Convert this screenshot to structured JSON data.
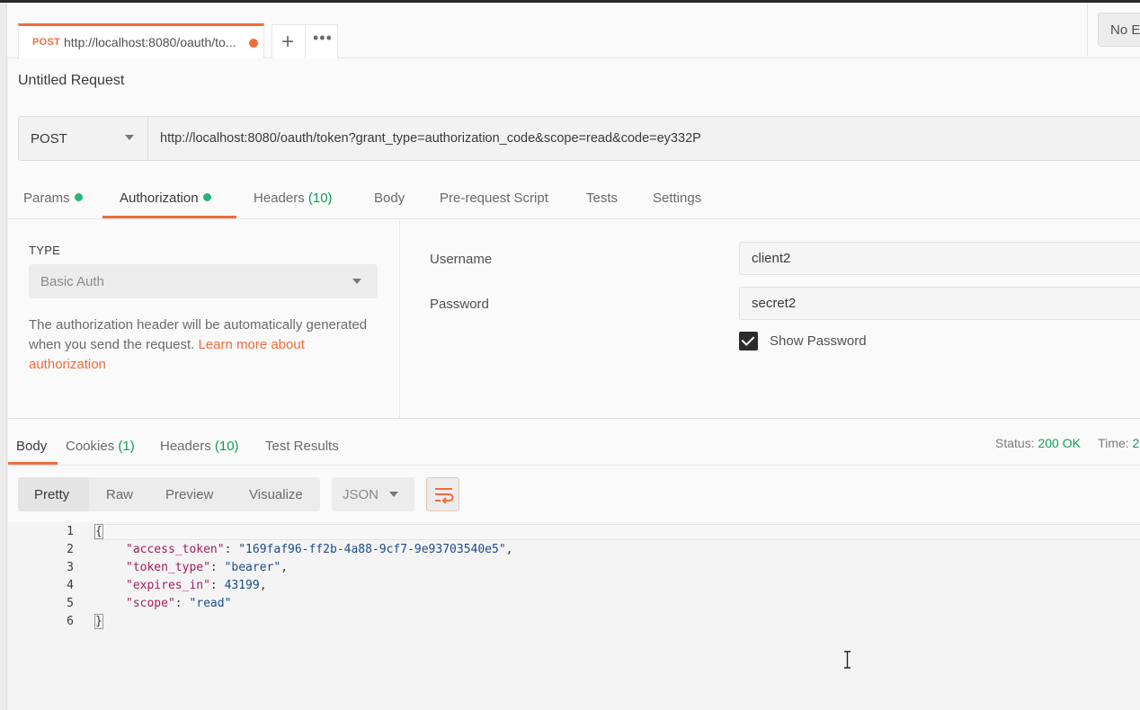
{
  "tab": {
    "method": "POST",
    "url": "http://localhost:8080/oauth/to...",
    "add_label": "+",
    "more_label": "•••"
  },
  "environment": {
    "label": "No E"
  },
  "request": {
    "title": "Untitled Request",
    "method": "POST",
    "url": "http://localhost:8080/oauth/token?grant_type=authorization_code&scope=read&code=ey332P"
  },
  "request_tabs": [
    {
      "label": "Params",
      "dot": true
    },
    {
      "label": "Authorization",
      "dot": true,
      "active": true
    },
    {
      "label": "Headers",
      "count": "(10)"
    },
    {
      "label": "Body"
    },
    {
      "label": "Pre-request Script"
    },
    {
      "label": "Tests"
    },
    {
      "label": "Settings"
    }
  ],
  "auth": {
    "type_label": "TYPE",
    "type_value": "Basic Auth",
    "description": "The authorization header will be automatically generated when you send the request.",
    "learn_more": "Learn more about authorization",
    "username_label": "Username",
    "username_value": "client2",
    "password_label": "Password",
    "password_value": "secret2",
    "show_password_label": "Show Password",
    "show_password_checked": true
  },
  "response_tabs": [
    {
      "label": "Body",
      "active": true
    },
    {
      "label": "Cookies",
      "count": "(1)"
    },
    {
      "label": "Headers",
      "count": "(10)"
    },
    {
      "label": "Test Results"
    }
  ],
  "status": {
    "status_label": "Status:",
    "status_value": "200 OK",
    "time_label": "Time:",
    "time_value": "2"
  },
  "format": {
    "buttons": [
      "Pretty",
      "Raw",
      "Preview",
      "Visualize"
    ],
    "active": "Pretty",
    "language": "JSON"
  },
  "response_body": {
    "line_numbers": [
      "1",
      "2",
      "3",
      "4",
      "5",
      "6"
    ],
    "open_brace": "{",
    "close_brace": "}",
    "entries": [
      {
        "key": "\"access_token\"",
        "value": "\"169faf96-ff2b-4a88-9cf7-9e93703540e5\"",
        "comma": ","
      },
      {
        "key": "\"token_type\"",
        "value": "\"bearer\"",
        "comma": ","
      },
      {
        "key": "\"expires_in\"",
        "value": "43199",
        "comma": ","
      },
      {
        "key": "\"scope\"",
        "value": "\"read\"",
        "comma": ""
      }
    ]
  },
  "colors": {
    "accent": "#f26b3a",
    "success": "#0f9d58",
    "json_key": "#a01e5d",
    "json_value": "#1c4a8a"
  }
}
